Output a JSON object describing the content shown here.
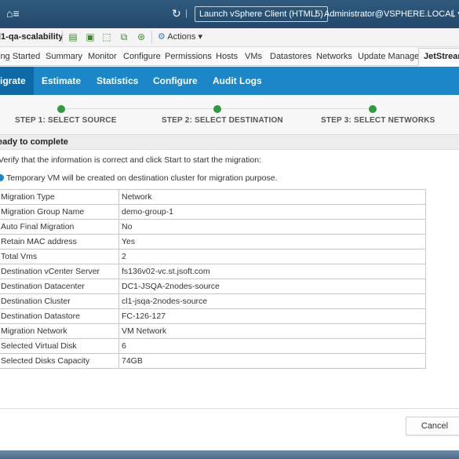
{
  "topbar": {
    "home_icon": "home-menu-icon",
    "launch_label": "Launch vSphere Client (HTML5)",
    "user_label": "Administrator@VSPHERE.LOCAL ▾",
    "sep": "|"
  },
  "object": {
    "title": "l1-qa-scalability",
    "actions_label": "Actions ▾"
  },
  "tabs": [
    "ing Started",
    "Summary",
    "Monitor",
    "Configure",
    "Permissions",
    "Hosts",
    "VMs",
    "Datastores",
    "Networks",
    "Update Manager",
    "JetStream"
  ],
  "nav": {
    "items": [
      "igrate",
      "Estimate",
      "Statistics",
      "Configure",
      "Audit Logs"
    ],
    "active_index": 0
  },
  "steps": [
    "STEP 1: SELECT SOURCE",
    "STEP 2: SELECT DESTINATION",
    "STEP 3: SELECT NETWORKS"
  ],
  "section_title": "eady to complete",
  "verify_text": "Verify that the information is correct and click Start to start the migration:",
  "info_text": "Temporary VM will be created on destination cluster for migration purpose.",
  "summary_rows": [
    {
      "key": "Migration Type",
      "value": "Network"
    },
    {
      "key": "Migration Group Name",
      "value": "demo-group-1"
    },
    {
      "key": "Auto Final Migration",
      "value": "No"
    },
    {
      "key": "Retain MAC address",
      "value": "Yes"
    },
    {
      "key": "Total Vms",
      "value": "2"
    },
    {
      "key": "Destination vCenter Server",
      "value": "fs136v02-vc.st.jsoft.com"
    },
    {
      "key": "Destination Datacenter",
      "value": "DC1-JSQA-2nodes-source"
    },
    {
      "key": "Destination Cluster",
      "value": "cl1-jsqa-2nodes-source"
    },
    {
      "key": "Destination Datastore",
      "value": "FC-126-127"
    },
    {
      "key": "Migration Network",
      "value": "VM Network"
    },
    {
      "key": "Selected Virtual Disk",
      "value": "6"
    },
    {
      "key": "Selected Disks Capacity",
      "value": "74GB"
    }
  ],
  "footer": {
    "cancel_label": "Cancel"
  },
  "colors": {
    "nav_blue": "#1b87c8",
    "nav_active": "#0e6aa6",
    "step_green": "#2e9c3e",
    "header_blue": "#23496b"
  }
}
